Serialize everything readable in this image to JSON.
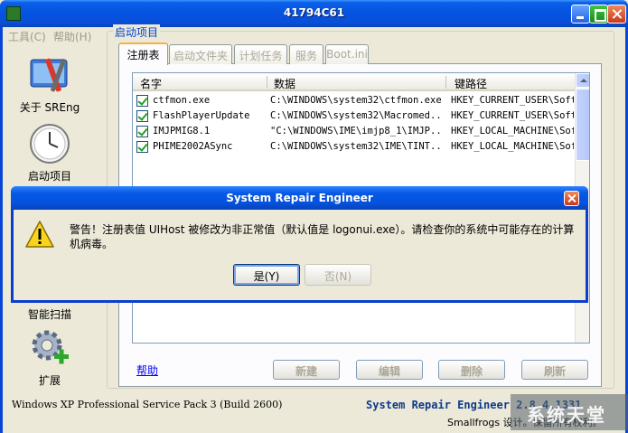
{
  "window": {
    "title": "41794C61"
  },
  "menu": [
    {
      "label": "工具(C)"
    },
    {
      "label": "帮助(H)"
    }
  ],
  "sidebar": {
    "items": [
      {
        "label": "关于 SREng",
        "icon": "tools-icon"
      },
      {
        "label": "启动项目",
        "icon": "clock-icon"
      },
      {
        "label": "智能扫描",
        "icon": "scan-icon"
      },
      {
        "label": "扩展",
        "icon": "gear-plus-icon"
      }
    ]
  },
  "group": {
    "title": "启动项目"
  },
  "tabs": [
    {
      "label": "注册表",
      "active": true
    },
    {
      "label": "启动文件夹",
      "active": false
    },
    {
      "label": "计划任务",
      "active": false
    },
    {
      "label": "服务",
      "active": false
    },
    {
      "label": "Boot.ini",
      "active": false
    }
  ],
  "table": {
    "columns": [
      "名字",
      "数据",
      "键路径"
    ],
    "rows": [
      {
        "name": "ctfmon.exe",
        "data": "C:\\WINDOWS\\system32\\ctfmon.exe",
        "key": "HKEY_CURRENT_USER\\Softw"
      },
      {
        "name": "FlashPlayerUpdate",
        "data": "C:\\WINDOWS\\system32\\Macromed...",
        "key": "HKEY_CURRENT_USER\\Softw"
      },
      {
        "name": "IMJPMIG8.1",
        "data": "\"C:\\WINDOWS\\IME\\imjp8_1\\IMJP...",
        "key": "HKEY_LOCAL_MACHINE\\Sof"
      },
      {
        "name": "PHIME2002ASync",
        "data": "C:\\WINDOWS\\system32\\IME\\TINT...",
        "key": "HKEY_LOCAL_MACHINE\\Sof"
      }
    ]
  },
  "help_link": "帮助",
  "buttons": {
    "new": "新建",
    "edit": "编辑",
    "delete": "删除",
    "refresh": "刷新"
  },
  "status": {
    "os": "Windows XP Professional Service Pack 3 (Build 2600)",
    "product": "System Repair Engineer 2.8.4.1331",
    "copyright": "Smallfrogs 设计。保留所有权利。"
  },
  "watermark": "系统天堂",
  "dialog": {
    "title": "System Repair Engineer",
    "message": "警告！注册表值 UIHost 被修改为非正常值（默认值是 logonui.exe）。请检查你的系统中可能存在的计算机病毒。",
    "yes_label": "是(Y)",
    "no_label": "否(N)"
  },
  "colors": {
    "titlebar": "#0553e0",
    "face": "#ece9d8",
    "link": "#0000ff"
  }
}
